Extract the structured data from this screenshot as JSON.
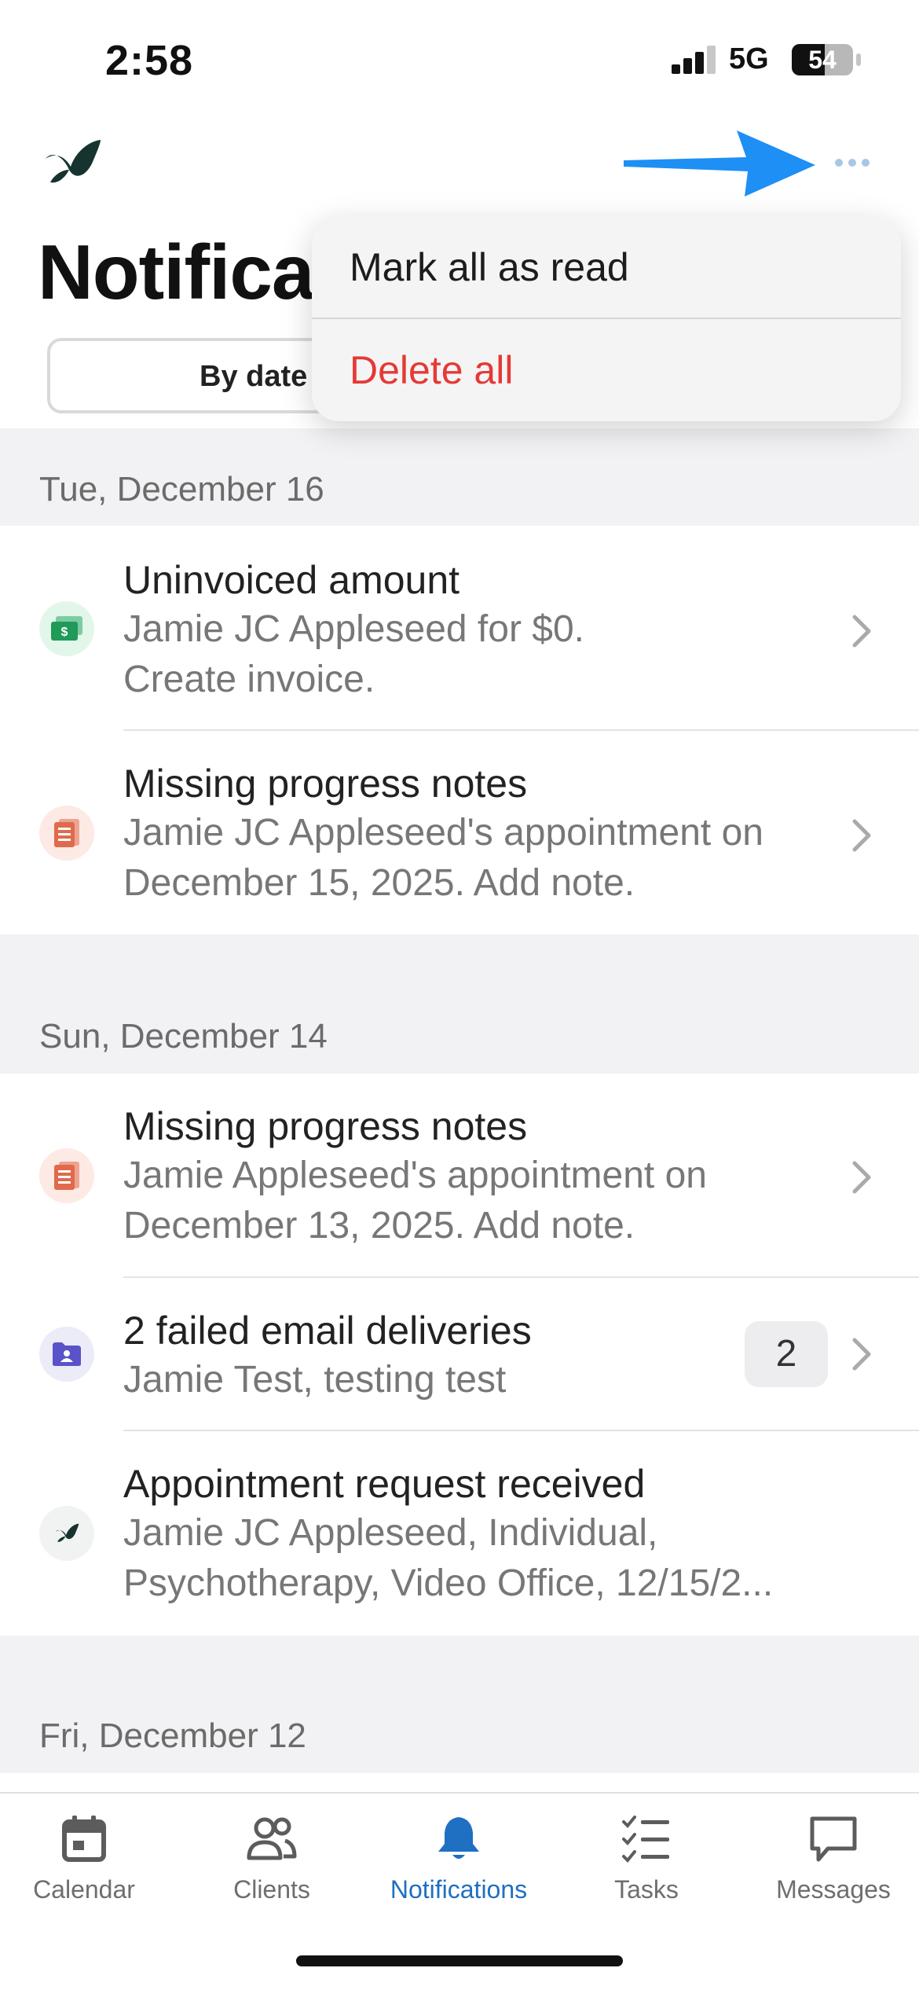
{
  "status_bar": {
    "time": "2:58",
    "network": "5G",
    "battery": "54",
    "battery_level": 0.54
  },
  "header": {
    "title": "Notifications",
    "segment_label": "By date",
    "more_icon": "ellipsis-icon",
    "annotation": "blue-arrow-pointing-at-menu"
  },
  "menu": {
    "mark_all": "Mark all as read",
    "delete_all": "Delete all",
    "delete_color": "#e53935"
  },
  "sections": [
    {
      "date": "Tue, December 16",
      "items": [
        {
          "icon": "money-icon",
          "title": "Uninvoiced amount",
          "line1": "Jamie JC Appleseed for $0.",
          "line2": "Create invoice."
        },
        {
          "icon": "document-icon",
          "title": "Missing progress notes",
          "line1": "Jamie JC Appleseed's appointment on",
          "line2": "December 15, 2025. Add note."
        }
      ]
    },
    {
      "date": "Sun, December 14",
      "items": [
        {
          "icon": "document-icon",
          "title": "Missing progress notes",
          "line1": "Jamie Appleseed's appointment on",
          "line2": "December 13, 2025. Add note."
        },
        {
          "icon": "contact-folder-icon",
          "title": "2 failed email deliveries",
          "line1": "Jamie Test, testing test",
          "badge": "2"
        },
        {
          "icon": "brand-leaf-icon",
          "title": "Appointment request received",
          "line1": "Jamie JC Appleseed, Individual,",
          "line2": "Psychotherapy, Video Office, 12/15/2..."
        }
      ]
    },
    {
      "date": "Fri, December 12"
    }
  ],
  "tabs": [
    {
      "label": "Calendar",
      "icon": "calendar-icon"
    },
    {
      "label": "Clients",
      "icon": "people-icon"
    },
    {
      "label": "Notifications",
      "icon": "bell-icon",
      "active": true
    },
    {
      "label": "Tasks",
      "icon": "checklist-icon"
    },
    {
      "label": "Messages",
      "icon": "chat-bubble-icon"
    }
  ],
  "colors": {
    "accent": "#1f6fc2",
    "brand": "#17332f",
    "delete": "#e53935",
    "annotation_arrow": "#1e8ff5"
  }
}
